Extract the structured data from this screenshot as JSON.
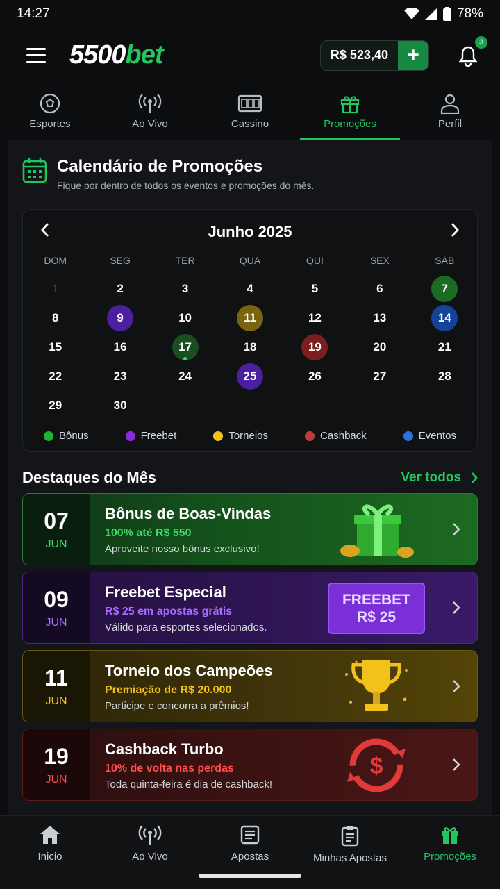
{
  "status": {
    "time": "14:27",
    "battery": "78%"
  },
  "header": {
    "logo_num": "5500",
    "logo_bet": "bet",
    "balance": "R$ 523,40",
    "plus": "+",
    "notif_count": "3"
  },
  "tabs": [
    {
      "label": "Esportes",
      "icon": "soccer-ball-icon"
    },
    {
      "label": "Ao Vivo",
      "icon": "broadcast-icon"
    },
    {
      "label": "Cassino",
      "icon": "slot-machine-icon"
    },
    {
      "label": "Promoções",
      "icon": "gift-icon",
      "active": true
    },
    {
      "label": "Perfil",
      "icon": "user-icon"
    }
  ],
  "calendar_section": {
    "title": "Calendário de Promoções",
    "subtitle": "Fique por dentro de todos os eventos e promoções do mês.",
    "month": "Junho 2025",
    "day_names": [
      "DOM",
      "SEG",
      "TER",
      "QUA",
      "QUI",
      "SEX",
      "SÁB"
    ],
    "days": [
      [
        "1",
        "2",
        "3",
        "4",
        "5",
        "6",
        "7"
      ],
      [
        "8",
        "9",
        "10",
        "11",
        "12",
        "13",
        "14"
      ],
      [
        "15",
        "16",
        "17",
        "18",
        "19",
        "20",
        "21"
      ],
      [
        "22",
        "23",
        "24",
        "25",
        "26",
        "27",
        "28"
      ],
      [
        "29",
        "30",
        "",
        "",
        "",
        "",
        ""
      ]
    ],
    "legend": [
      {
        "label": "Bônus",
        "color": "#22b030"
      },
      {
        "label": "Freebet",
        "color": "#8a2be2"
      },
      {
        "label": "Torneios",
        "color": "#f2c21a"
      },
      {
        "label": "Cashback",
        "color": "#c43a3a"
      },
      {
        "label": "Eventos",
        "color": "#2f6fe6"
      }
    ]
  },
  "highlights": {
    "title": "Destaques do Mês",
    "see_all": "Ver todos",
    "items": [
      {
        "day": "07",
        "month": "JUN",
        "title": "Bônus de Boas-Vindas",
        "sub": "100% até R$ 550",
        "desc": "Aproveite nosso bônus exclusivo!"
      },
      {
        "day": "09",
        "month": "JUN",
        "title": "Freebet Especial",
        "sub": "R$ 25 em apostas grátis",
        "desc": "Válido para esportes selecionados.",
        "badge1": "FREEBET",
        "badge2": "R$ 25"
      },
      {
        "day": "11",
        "month": "JUN",
        "title": "Torneio dos Campeões",
        "sub": "Premiação de R$ 20.000",
        "desc": "Participe e concorra a prêmios!"
      },
      {
        "day": "19",
        "month": "JUN",
        "title": "Cashback Turbo",
        "sub": "10% de volta nas perdas",
        "desc": "Toda quinta-feira é dia de cashback!"
      }
    ]
  },
  "bottom_nav": [
    {
      "label": "Inicio",
      "icon": "home-icon"
    },
    {
      "label": "Ao Vivo",
      "icon": "broadcast-icon"
    },
    {
      "label": "Apostas",
      "icon": "document-icon"
    },
    {
      "label": "Minhas Apostas",
      "icon": "clipboard-icon"
    },
    {
      "label": "Promoções",
      "icon": "gift-icon",
      "active": true
    }
  ]
}
